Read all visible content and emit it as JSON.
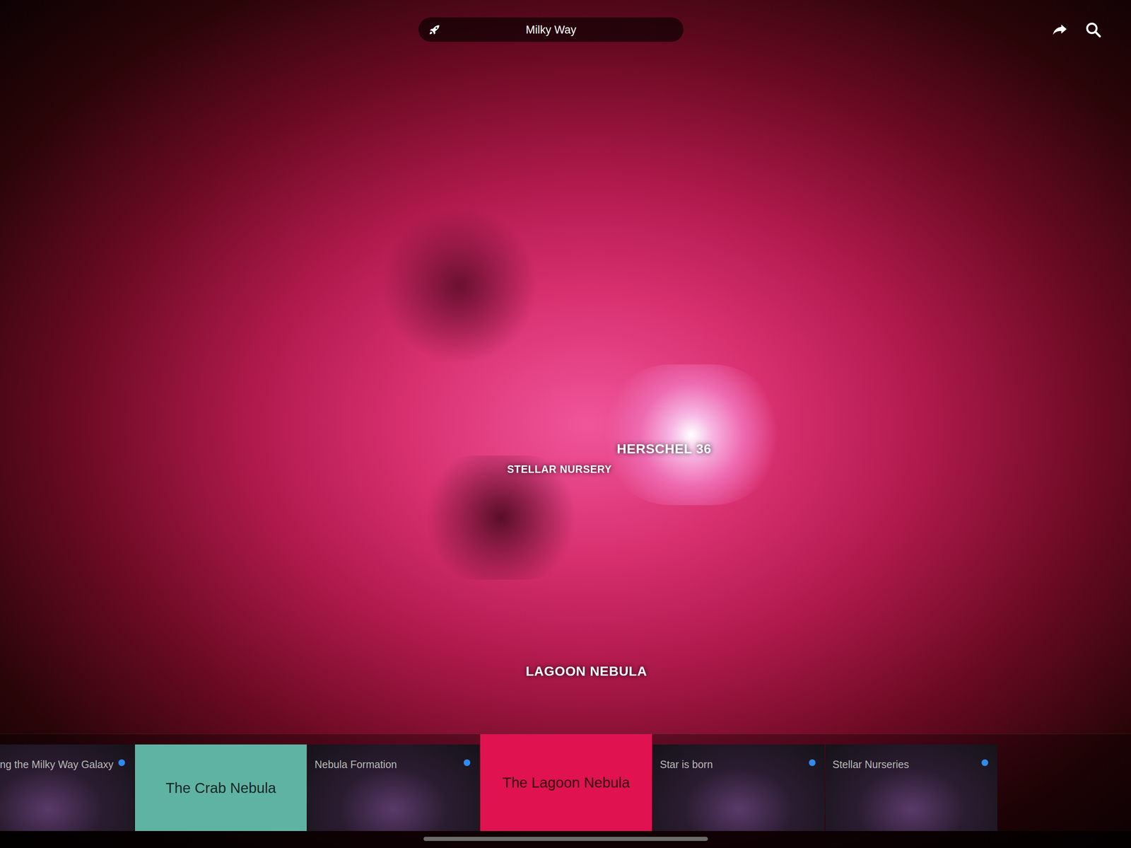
{
  "top_bar": {
    "location": "Milky Way"
  },
  "sky_labels": [
    {
      "text": "HERSCHEL 36",
      "size": "large"
    },
    {
      "text": "STELLAR NURSERY",
      "size": "small"
    },
    {
      "text": "LAGOON NEBULA",
      "size": "large"
    }
  ],
  "cards": [
    {
      "title": "ng the Milky Way Galaxy",
      "kind": "image",
      "selected": false,
      "unread": true
    },
    {
      "title": "The Crab Nebula",
      "kind": "color",
      "selected": false,
      "color": "#5fb3a3"
    },
    {
      "title": "Nebula Formation",
      "kind": "image",
      "selected": false,
      "unread": true
    },
    {
      "title": "The Lagoon Nebula",
      "kind": "color",
      "selected": true,
      "color": "#e0124f"
    },
    {
      "title": "Star is born",
      "kind": "image",
      "selected": false,
      "unread": true
    },
    {
      "title": "Stellar Nurseries",
      "kind": "image",
      "selected": false,
      "unread": true
    }
  ]
}
